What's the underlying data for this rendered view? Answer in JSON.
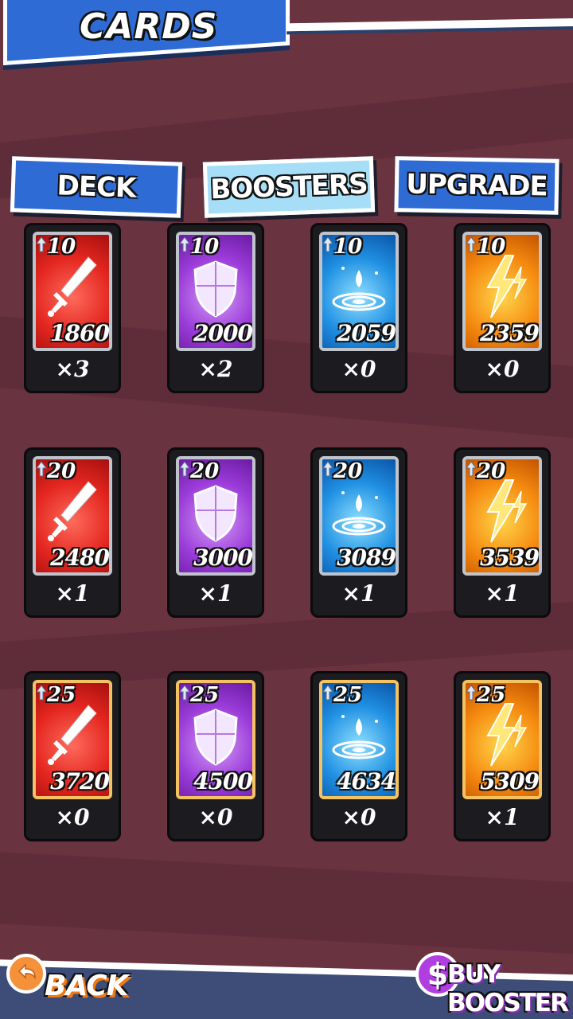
{
  "header": {
    "title": "CARDS"
  },
  "tabs": [
    {
      "label": "DECK",
      "active": false
    },
    {
      "label": "BOOSTERS",
      "active": true
    },
    {
      "label": "UPGRADE",
      "active": false
    }
  ],
  "cards": [
    {
      "level": "10",
      "power": "1860",
      "count": "×3",
      "element": "sword",
      "color": "red"
    },
    {
      "level": "10",
      "power": "2000",
      "count": "×2",
      "element": "shield",
      "color": "purple"
    },
    {
      "level": "10",
      "power": "2059",
      "count": "×0",
      "element": "water",
      "color": "blue"
    },
    {
      "level": "10",
      "power": "2359",
      "count": "×0",
      "element": "lightning",
      "color": "orange"
    },
    {
      "level": "20",
      "power": "2480",
      "count": "×1",
      "element": "sword",
      "color": "red"
    },
    {
      "level": "20",
      "power": "3000",
      "count": "×1",
      "element": "shield",
      "color": "purple"
    },
    {
      "level": "20",
      "power": "3089",
      "count": "×1",
      "element": "water",
      "color": "blue"
    },
    {
      "level": "20",
      "power": "3539",
      "count": "×1",
      "element": "lightning",
      "color": "orange"
    },
    {
      "level": "25",
      "power": "3720",
      "count": "×0",
      "element": "sword",
      "color": "red"
    },
    {
      "level": "25",
      "power": "4500",
      "count": "×0",
      "element": "shield",
      "color": "purple"
    },
    {
      "level": "25",
      "power": "4634",
      "count": "×0",
      "element": "water",
      "color": "blue"
    },
    {
      "level": "25",
      "power": "5309",
      "count": "×1",
      "element": "lightning",
      "color": "orange"
    }
  ],
  "footer": {
    "back_label": "BACK",
    "buy_label": "BUY BOOSTER",
    "buy_icon": "$"
  }
}
